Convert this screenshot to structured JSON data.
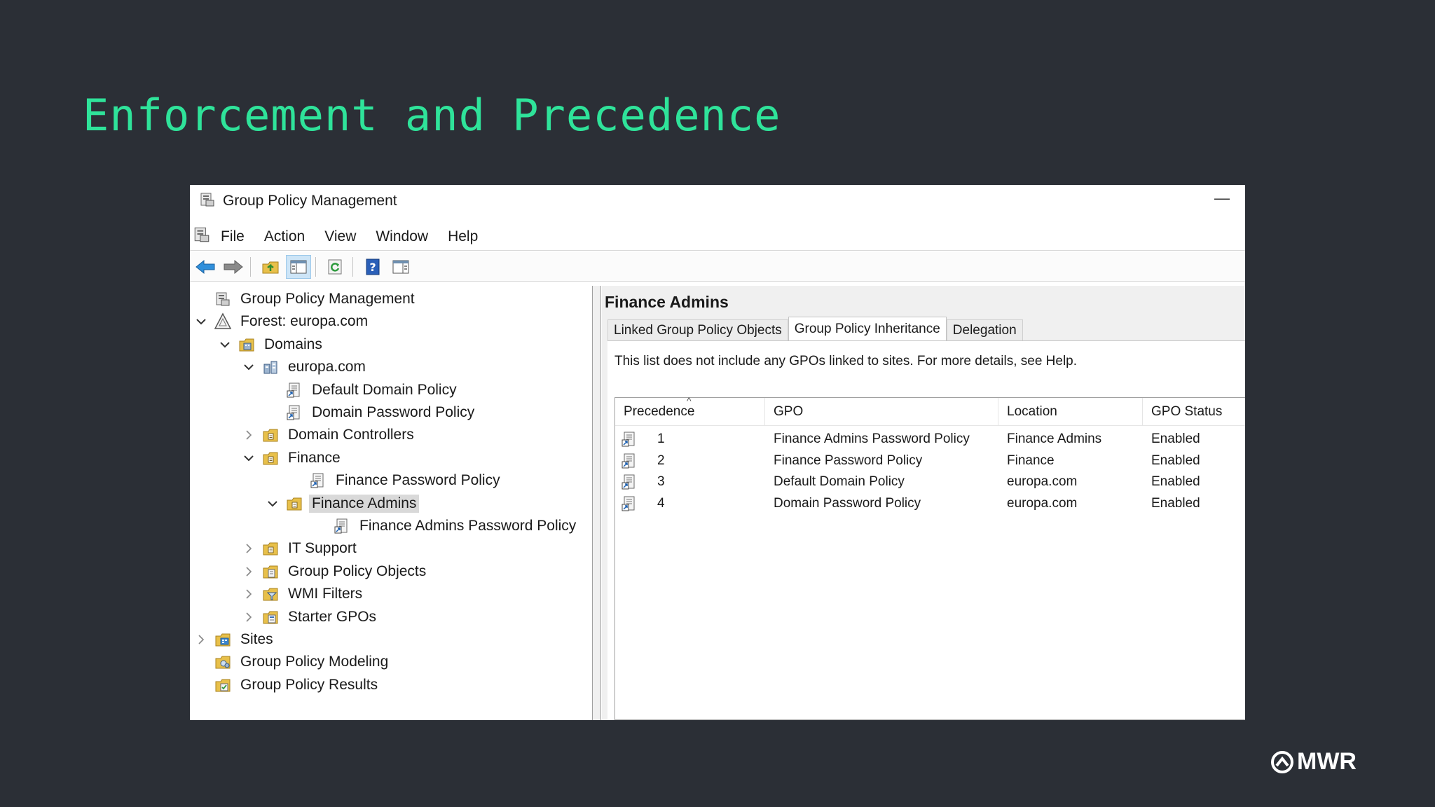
{
  "slide": {
    "title": "Enforcement and Precedence"
  },
  "window": {
    "title": "Group Policy Management",
    "minimize_glyph": "—"
  },
  "menu": {
    "items": [
      "File",
      "Action",
      "View",
      "Window",
      "Help"
    ]
  },
  "toolbar": {
    "buttons": [
      "back-icon",
      "forward-icon",
      "up-folder-icon",
      "show-hide-tree-icon",
      "refresh-icon",
      "help-icon",
      "properties-icon"
    ]
  },
  "tree": {
    "nodes": [
      {
        "label": "Group Policy Management",
        "level": 0,
        "expander": "",
        "icon": "gpm-console-icon"
      },
      {
        "label": "Forest: europa.com",
        "level": 0,
        "expander": "expanded",
        "icon": "forest-icon"
      },
      {
        "label": "Domains",
        "level": 1,
        "expander": "expanded",
        "icon": "domains-folder-icon"
      },
      {
        "label": "europa.com",
        "level": 2,
        "expander": "expanded",
        "icon": "domain-icon"
      },
      {
        "label": "Default Domain Policy",
        "level": 3,
        "expander": "",
        "icon": "gpo-link-icon"
      },
      {
        "label": "Domain Password Policy",
        "level": 3,
        "expander": "",
        "icon": "gpo-link-icon"
      },
      {
        "label": "Domain Controllers",
        "level": 2,
        "expander": "collapsed",
        "icon": "ou-folder-icon"
      },
      {
        "label": "Finance",
        "level": 2,
        "expander": "expanded",
        "icon": "ou-folder-icon"
      },
      {
        "label": "Finance Password Policy",
        "level": 4,
        "expander": "",
        "icon": "gpo-link-icon"
      },
      {
        "label": "Finance Admins",
        "level": 3,
        "expander": "expanded",
        "icon": "ou-folder-icon",
        "selected": true
      },
      {
        "label": "Finance Admins Password Policy",
        "level": 5,
        "expander": "",
        "icon": "gpo-link-icon"
      },
      {
        "label": "IT Support",
        "level": 2,
        "expander": "collapsed",
        "icon": "ou-folder-icon"
      },
      {
        "label": "Group Policy Objects",
        "level": 2,
        "expander": "collapsed",
        "icon": "gpo-container-icon"
      },
      {
        "label": "WMI Filters",
        "level": 2,
        "expander": "collapsed",
        "icon": "wmi-filter-icon"
      },
      {
        "label": "Starter GPOs",
        "level": 2,
        "expander": "collapsed",
        "icon": "starter-gpo-icon"
      },
      {
        "label": "Sites",
        "level": 0,
        "expander": "collapsed",
        "icon": "sites-icon"
      },
      {
        "label": "Group Policy Modeling",
        "level": 0,
        "expander": "",
        "icon": "modeling-icon"
      },
      {
        "label": "Group Policy Results",
        "level": 0,
        "expander": "",
        "icon": "results-icon"
      }
    ]
  },
  "detail": {
    "title": "Finance Admins",
    "tabs": [
      {
        "label": "Linked Group Policy Objects",
        "active": false
      },
      {
        "label": "Group Policy Inheritance",
        "active": true
      },
      {
        "label": "Delegation",
        "active": false
      }
    ],
    "info": "This list does not include any GPOs linked to sites. For more details, see Help.",
    "table": {
      "sort_glyph": "^",
      "columns": [
        "Precedence",
        "GPO",
        "Location",
        "GPO Status"
      ],
      "rows": [
        {
          "precedence": "1",
          "gpo": "Finance Admins Password Policy",
          "location": "Finance Admins",
          "status": "Enabled"
        },
        {
          "precedence": "2",
          "gpo": "Finance Password Policy",
          "location": "Finance",
          "status": "Enabled"
        },
        {
          "precedence": "3",
          "gpo": "Default Domain Policy",
          "location": "europa.com",
          "status": "Enabled"
        },
        {
          "precedence": "4",
          "gpo": "Domain Password Policy",
          "location": "europa.com",
          "status": "Enabled"
        }
      ]
    }
  },
  "brand": {
    "name": "MWR"
  },
  "colors": {
    "background": "#2b2f36",
    "title_accent": "#2fe39a",
    "selection": "#d9d9d9"
  }
}
